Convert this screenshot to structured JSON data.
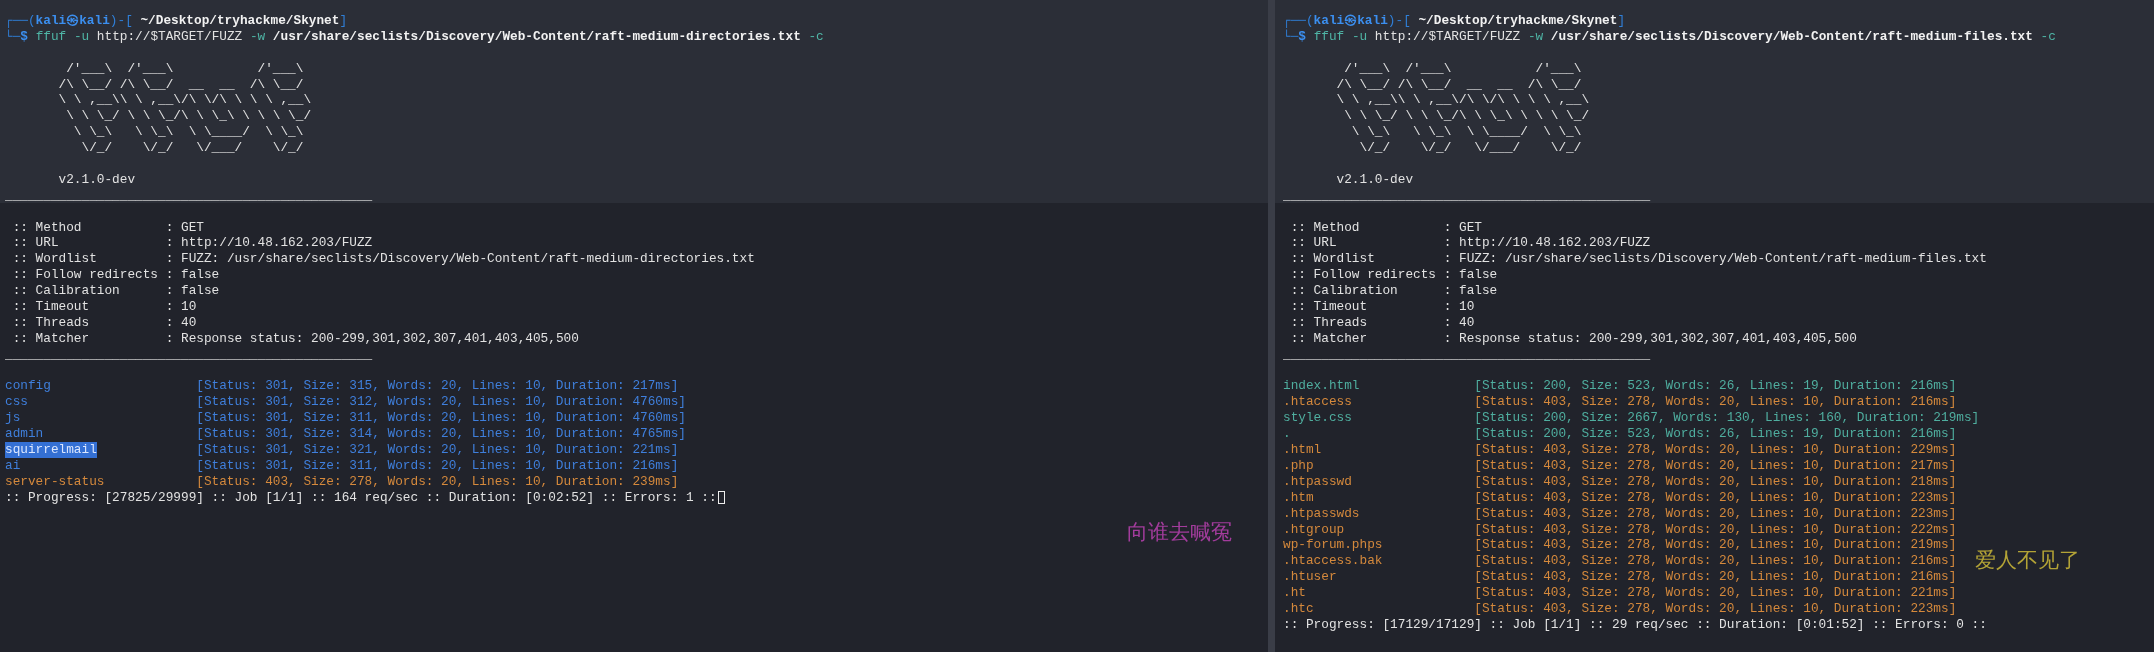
{
  "panes": [
    {
      "lines": [
        {
          "kind": "prompt",
          "segments": [
            {
              "kind": "frame",
              "text": "┌──("
            },
            {
              "kind": "user",
              "text": "kali㉿kali"
            },
            {
              "kind": "frame",
              "text": ")-["
            },
            {
              "kind": "path",
              "text": "~/Desktop/tryhackme/Skynet"
            },
            {
              "kind": "frame",
              "text": "]"
            }
          ]
        },
        {
          "kind": "prompt",
          "segments": [
            {
              "kind": "frame",
              "text": "└─"
            },
            {
              "kind": "user",
              "text": "$"
            },
            {
              "kind": "cmd",
              "text": "ffuf"
            },
            {
              "kind": "flag",
              "text": "-u"
            },
            {
              "kind": "plain",
              "text": "http://$TARGET/FUZZ"
            },
            {
              "kind": "flag",
              "text": "-w"
            },
            {
              "kind": "path",
              "text": "/usr/share/seclists/Discovery/Web-Content/raft-medium-directories.txt"
            },
            {
              "kind": "flag",
              "text": "-c"
            }
          ]
        },
        {
          "kind": "blank"
        },
        {
          "kind": "art",
          "text": "        /'___\\  /'___\\           /'___\\"
        },
        {
          "kind": "art",
          "text": "       /\\ \\__/ /\\ \\__/  __  __  /\\ \\__/"
        },
        {
          "kind": "art",
          "text": "       \\ \\ ,__\\\\ \\ ,__\\/\\ \\/\\ \\ \\ \\ ,__\\"
        },
        {
          "kind": "art",
          "text": "        \\ \\ \\_/ \\ \\ \\_/\\ \\ \\_\\ \\ \\ \\ \\_/"
        },
        {
          "kind": "art",
          "text": "         \\ \\_\\   \\ \\_\\  \\ \\____/  \\ \\_\\"
        },
        {
          "kind": "art",
          "text": "          \\/_/    \\/_/   \\/___/    \\/_/"
        },
        {
          "kind": "blank"
        },
        {
          "kind": "version",
          "text": "       v2.1.0-dev"
        },
        {
          "kind": "separator",
          "text": "________________________________________________"
        },
        {
          "kind": "blank"
        },
        {
          "kind": "setting",
          "text": " :: Method           : GET"
        },
        {
          "kind": "setting",
          "text": " :: URL              : http://10.48.162.203/FUZZ"
        },
        {
          "kind": "setting",
          "text": " :: Wordlist         : FUZZ: /usr/share/seclists/Discovery/Web-Content/raft-medium-directories.txt"
        },
        {
          "kind": "setting",
          "text": " :: Follow redirects : false"
        },
        {
          "kind": "setting",
          "text": " :: Calibration      : false"
        },
        {
          "kind": "setting",
          "text": " :: Timeout          : 10"
        },
        {
          "kind": "setting",
          "text": " :: Threads          : 40"
        },
        {
          "kind": "setting",
          "text": " :: Matcher          : Response status: 200-299,301,302,307,401,403,405,500"
        },
        {
          "kind": "separator",
          "text": "________________________________________________"
        },
        {
          "kind": "blank"
        },
        {
          "kind": "result",
          "name": "config",
          "result": "[Status: 301, Size: 315, Words: 20, Lines: 10, Duration: 217ms]",
          "color": "#3f7fdc",
          "selected": false
        },
        {
          "kind": "result",
          "name": "css",
          "result": "[Status: 301, Size: 312, Words: 20, Lines: 10, Duration: 4760ms]",
          "color": "#3f7fdc",
          "selected": false
        },
        {
          "kind": "result",
          "name": "js",
          "result": "[Status: 301, Size: 311, Words: 20, Lines: 10, Duration: 4760ms]",
          "color": "#3f7fdc",
          "selected": false
        },
        {
          "kind": "result",
          "name": "admin",
          "result": "[Status: 301, Size: 314, Words: 20, Lines: 10, Duration: 4765ms]",
          "color": "#3f7fdc",
          "selected": false
        },
        {
          "kind": "result",
          "name": "squirrelmail",
          "result": "[Status: 301, Size: 321, Words: 20, Lines: 10, Duration: 221ms]",
          "color": "#3f7fdc",
          "selected": true
        },
        {
          "kind": "result",
          "name": "ai",
          "result": "[Status: 301, Size: 311, Words: 20, Lines: 10, Duration: 216ms]",
          "color": "#3f7fdc",
          "selected": false
        },
        {
          "kind": "result",
          "name": "server-status",
          "result": "[Status: 403, Size: 278, Words: 20, Lines: 10, Duration: 239ms]",
          "color": "#d5893c",
          "selected": false
        },
        {
          "kind": "progress",
          "text": ":: Progress: [27825/29999] :: Job [1/1] :: 164 req/sec :: Duration: [0:02:52] :: Errors: 1 ::",
          "cursor": true
        }
      ]
    },
    {
      "lines": [
        {
          "kind": "prompt",
          "segments": [
            {
              "kind": "frame",
              "text": "┌──("
            },
            {
              "kind": "user",
              "text": "kali㉿kali"
            },
            {
              "kind": "frame",
              "text": ")-["
            },
            {
              "kind": "path",
              "text": "~/Desktop/tryhackme/Skynet"
            },
            {
              "kind": "frame",
              "text": "]"
            }
          ]
        },
        {
          "kind": "prompt",
          "segments": [
            {
              "kind": "frame",
              "text": "└─"
            },
            {
              "kind": "user",
              "text": "$"
            },
            {
              "kind": "cmd",
              "text": "ffuf"
            },
            {
              "kind": "flag",
              "text": "-u"
            },
            {
              "kind": "plain",
              "text": "http://$TARGET/FUZZ"
            },
            {
              "kind": "flag",
              "text": "-w"
            },
            {
              "kind": "path",
              "text": "/usr/share/seclists/Discovery/Web-Content/raft-medium-files.txt"
            },
            {
              "kind": "flag",
              "text": "-c"
            }
          ]
        },
        {
          "kind": "blank"
        },
        {
          "kind": "art",
          "text": "        /'___\\  /'___\\           /'___\\"
        },
        {
          "kind": "art",
          "text": "       /\\ \\__/ /\\ \\__/  __  __  /\\ \\__/"
        },
        {
          "kind": "art",
          "text": "       \\ \\ ,__\\\\ \\ ,__\\/\\ \\/\\ \\ \\ \\ ,__\\"
        },
        {
          "kind": "art",
          "text": "        \\ \\ \\_/ \\ \\ \\_/\\ \\ \\_\\ \\ \\ \\ \\_/"
        },
        {
          "kind": "art",
          "text": "         \\ \\_\\   \\ \\_\\  \\ \\____/  \\ \\_\\"
        },
        {
          "kind": "art",
          "text": "          \\/_/    \\/_/   \\/___/    \\/_/"
        },
        {
          "kind": "blank"
        },
        {
          "kind": "version",
          "text": "       v2.1.0-dev"
        },
        {
          "kind": "separator",
          "text": "________________________________________________"
        },
        {
          "kind": "blank"
        },
        {
          "kind": "setting",
          "text": " :: Method           : GET"
        },
        {
          "kind": "setting",
          "text": " :: URL              : http://10.48.162.203/FUZZ"
        },
        {
          "kind": "setting",
          "text": " :: Wordlist         : FUZZ: /usr/share/seclists/Discovery/Web-Content/raft-medium-files.txt"
        },
        {
          "kind": "setting",
          "text": " :: Follow redirects : false"
        },
        {
          "kind": "setting",
          "text": " :: Calibration      : false"
        },
        {
          "kind": "setting",
          "text": " :: Timeout          : 10"
        },
        {
          "kind": "setting",
          "text": " :: Threads          : 40"
        },
        {
          "kind": "setting",
          "text": " :: Matcher          : Response status: 200-299,301,302,307,401,403,405,500"
        },
        {
          "kind": "separator",
          "text": "________________________________________________"
        },
        {
          "kind": "blank"
        },
        {
          "kind": "result",
          "name": "index.html",
          "result": "[Status: 200, Size: 523, Words: 26, Lines: 19, Duration: 216ms]",
          "color": "#4fae9f",
          "selected": false
        },
        {
          "kind": "result",
          "name": ".htaccess",
          "result": "[Status: 403, Size: 278, Words: 20, Lines: 10, Duration: 216ms]",
          "color": "#d5893c",
          "selected": false
        },
        {
          "kind": "result",
          "name": "style.css",
          "result": "[Status: 200, Size: 2667, Words: 130, Lines: 160, Duration: 219ms]",
          "color": "#4fae9f",
          "selected": false
        },
        {
          "kind": "result",
          "name": ".",
          "result": "[Status: 200, Size: 523, Words: 26, Lines: 19, Duration: 216ms]",
          "color": "#4fae9f",
          "selected": false
        },
        {
          "kind": "result",
          "name": ".html",
          "result": "[Status: 403, Size: 278, Words: 20, Lines: 10, Duration: 229ms]",
          "color": "#d5893c",
          "selected": false
        },
        {
          "kind": "result",
          "name": ".php",
          "result": "[Status: 403, Size: 278, Words: 20, Lines: 10, Duration: 217ms]",
          "color": "#d5893c",
          "selected": false
        },
        {
          "kind": "result",
          "name": ".htpasswd",
          "result": "[Status: 403, Size: 278, Words: 20, Lines: 10, Duration: 218ms]",
          "color": "#d5893c",
          "selected": false
        },
        {
          "kind": "result",
          "name": ".htm",
          "result": "[Status: 403, Size: 278, Words: 20, Lines: 10, Duration: 223ms]",
          "color": "#d5893c",
          "selected": false
        },
        {
          "kind": "result",
          "name": ".htpasswds",
          "result": "[Status: 403, Size: 278, Words: 20, Lines: 10, Duration: 223ms]",
          "color": "#d5893c",
          "selected": false
        },
        {
          "kind": "result",
          "name": ".htgroup",
          "result": "[Status: 403, Size: 278, Words: 20, Lines: 10, Duration: 222ms]",
          "color": "#d5893c",
          "selected": false
        },
        {
          "kind": "result",
          "name": "wp-forum.phps",
          "result": "[Status: 403, Size: 278, Words: 20, Lines: 10, Duration: 219ms]",
          "color": "#d5893c",
          "selected": false
        },
        {
          "kind": "result",
          "name": ".htaccess.bak",
          "result": "[Status: 403, Size: 278, Words: 20, Lines: 10, Duration: 216ms]",
          "color": "#d5893c",
          "selected": false
        },
        {
          "kind": "result",
          "name": ".htuser",
          "result": "[Status: 403, Size: 278, Words: 20, Lines: 10, Duration: 216ms]",
          "color": "#d5893c",
          "selected": false
        },
        {
          "kind": "result",
          "name": ".ht",
          "result": "[Status: 403, Size: 278, Words: 20, Lines: 10, Duration: 221ms]",
          "color": "#d5893c",
          "selected": false
        },
        {
          "kind": "result",
          "name": ".htc",
          "result": "[Status: 403, Size: 278, Words: 20, Lines: 10, Duration: 223ms]",
          "color": "#d5893c",
          "selected": false
        },
        {
          "kind": "progress",
          "text": ":: Progress: [17129/17129] :: Job [1/1] :: 29 req/sec :: Duration: [0:01:52] :: Errors: 0 ::",
          "cursor": false
        }
      ]
    }
  ],
  "desktop_lyrics": [
    {
      "text": "向谁去喊冤",
      "color": "#a23c9c"
    },
    {
      "text": "爱人不见了",
      "color": "#b3a336"
    }
  ]
}
